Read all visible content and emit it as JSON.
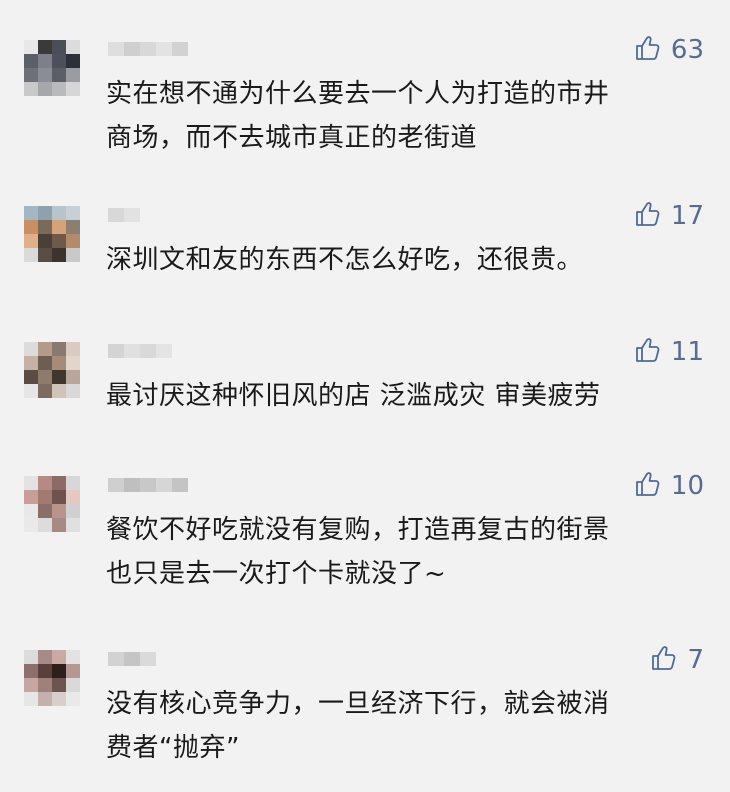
{
  "comments": [
    {
      "likes": "63",
      "lines": [
        "实在想不通为什么要去一个人为打造的市井",
        "商场，而不去城市真正的老街道"
      ],
      "avatar_colors": [
        "#e8e8e8",
        "#3a3a3a",
        "#4a4f57",
        "#dcdcdc",
        "#5a5f68",
        "#7d8089",
        "#4b505a",
        "#2c3038",
        "#6d7079",
        "#8a8d95",
        "#5b5e66",
        "#9a9ca2",
        "#c9c9c9",
        "#a5a7ac",
        "#b8babe",
        "#d6d6d6"
      ],
      "nick_colors": [
        "#dedede",
        "#cfcfcf",
        "#d8d8d8",
        "#e3e3e3",
        "#d2d2d2"
      ]
    },
    {
      "likes": "17",
      "lines": [
        "深圳文和友的东西不怎么好吃，还很贵。"
      ],
      "avatar_colors": [
        "#a3b6c3",
        "#8ea1ae",
        "#b7c4cc",
        "#c6d0d6",
        "#c98f62",
        "#7a6a5a",
        "#d6a379",
        "#8d7e6d",
        "#e1b08a",
        "#4a4038",
        "#6e5a48",
        "#b38b6a",
        "#dadada",
        "#5a4d44",
        "#3b332e",
        "#c9c9c9"
      ],
      "nick_colors": [
        "#d8d8d8",
        "#e2e2e2"
      ]
    },
    {
      "likes": "11",
      "lines": [
        "最讨厌这种怀旧风的店 泛滥成灾 审美疲劳"
      ],
      "avatar_colors": [
        "#dcdcdc",
        "#b59a88",
        "#8a7a6e",
        "#d9cbc0",
        "#c6b2a4",
        "#6e5d52",
        "#a58c78",
        "#e2d6cc",
        "#5b4b42",
        "#8f7b6c",
        "#403630",
        "#b8a69a",
        "#e6e6e6",
        "#7e6b5f",
        "#cfc3ba",
        "#d8d8d8"
      ],
      "nick_colors": [
        "#d4d4d4",
        "#e0e0e0",
        "#d9d9d9",
        "#e4e4e4"
      ]
    },
    {
      "likes": "10",
      "lines": [
        "餐饮不好吃就没有复购，打造再复古的街景",
        "也只是去一次打个卡就没了~"
      ],
      "avatar_colors": [
        "#e3e3e3",
        "#b58a84",
        "#8c6b66",
        "#d7d7d7",
        "#c99e96",
        "#a27a72",
        "#6d524e",
        "#e6c8c1",
        "#e8e8e8",
        "#8a6e68",
        "#b9948c",
        "#d0d0d0",
        "#e9e9e9",
        "#dcdcdc",
        "#a88a84",
        "#e0e0e0"
      ],
      "nick_colors": [
        "#cfcfcf",
        "#bfbfbf",
        "#c8c8c8",
        "#d6d6d6",
        "#c4c4c4"
      ]
    },
    {
      "likes": "7",
      "lines": [
        "没有核心竞争力，一旦经济下行，就会被消",
        "费者“抛弃”"
      ],
      "avatar_colors": [
        "#dcdcdc",
        "#a78b86",
        "#c9a9a3",
        "#e2e2e2",
        "#8e6f6a",
        "#5a403c",
        "#2e1f1c",
        "#b89692",
        "#c7a6a1",
        "#a0807b",
        "#6e5450",
        "#d9d9d9",
        "#e6e6e6",
        "#c4b0ac",
        "#d8cfcd",
        "#e9e9e9"
      ],
      "nick_colors": [
        "#d2d2d2",
        "#c5c5c5",
        "#dadada"
      ]
    }
  ]
}
